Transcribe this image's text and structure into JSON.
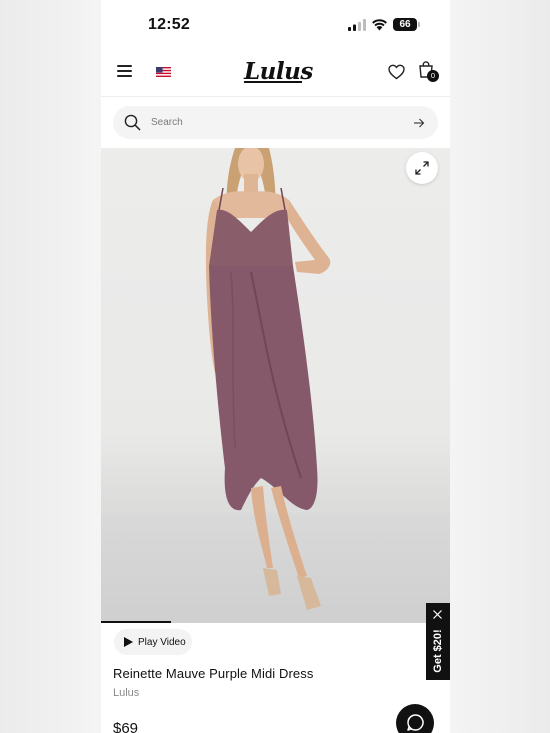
{
  "status_bar": {
    "time": "12:52",
    "battery": "66",
    "icons": [
      "signal-icon",
      "wifi-icon",
      "battery-icon"
    ]
  },
  "header": {
    "logo_text": "Lulus",
    "bag_count": "0",
    "icons": [
      "menu-icon",
      "us-flag-icon",
      "heart-icon",
      "shopping-bag-icon"
    ]
  },
  "search": {
    "placeholder": "Search",
    "icons": [
      "search-icon",
      "arrow-right-icon"
    ]
  },
  "product": {
    "image_alt": "Woman wearing a mauve purple midi dress",
    "image_position": "1 of 5",
    "image_progress": 0.2,
    "play_video_label": "Play Video",
    "name": "Reinette Mauve Purple Midi Dress",
    "brand": "Lulus",
    "price": "$69"
  },
  "promo": {
    "label": "Get $20!"
  },
  "colors": {
    "accent": "#111111",
    "dress": "#8a5d6a",
    "background": "#ffffff"
  }
}
